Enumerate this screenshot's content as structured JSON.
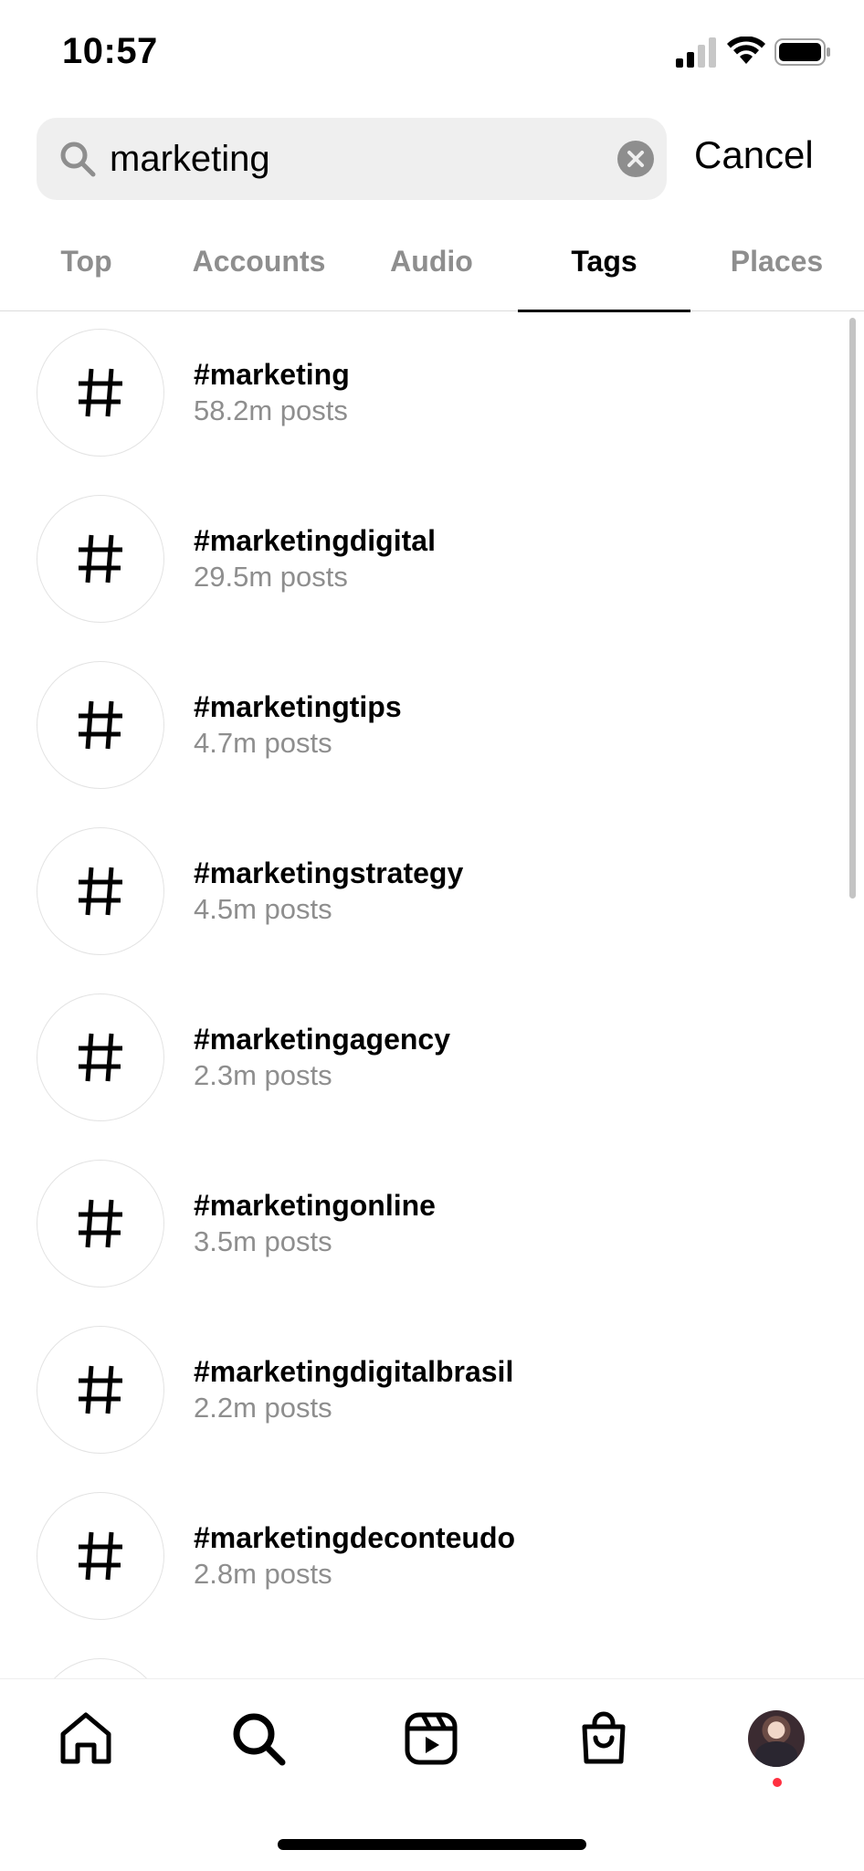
{
  "status_bar": {
    "time": "10:57"
  },
  "search": {
    "query": "marketing",
    "cancel_label": "Cancel"
  },
  "tabs": [
    {
      "label": "Top",
      "active": false
    },
    {
      "label": "Accounts",
      "active": false
    },
    {
      "label": "Audio",
      "active": false
    },
    {
      "label": "Tags",
      "active": true
    },
    {
      "label": "Places",
      "active": false
    }
  ],
  "tags": [
    {
      "name": "#marketing",
      "count": "58.2m posts"
    },
    {
      "name": "#marketingdigital",
      "count": "29.5m posts"
    },
    {
      "name": "#marketingtips",
      "count": "4.7m posts"
    },
    {
      "name": "#marketingstrategy",
      "count": "4.5m posts"
    },
    {
      "name": "#marketingagency",
      "count": "2.3m posts"
    },
    {
      "name": "#marketingonline",
      "count": "3.5m posts"
    },
    {
      "name": "#marketingdigitalbrasil",
      "count": "2.2m posts"
    },
    {
      "name": "#marketingdeconteudo",
      "count": "2.8m posts"
    }
  ],
  "bottom_nav": {
    "items": [
      {
        "icon": "home-icon"
      },
      {
        "icon": "search-icon",
        "active": true
      },
      {
        "icon": "reels-icon"
      },
      {
        "icon": "shop-icon"
      },
      {
        "icon": "profile-avatar",
        "has_notification": true
      }
    ]
  },
  "colors": {
    "secondary_text": "#8e8e8e",
    "search_bg": "#efefef",
    "notification": "#ff3040"
  }
}
